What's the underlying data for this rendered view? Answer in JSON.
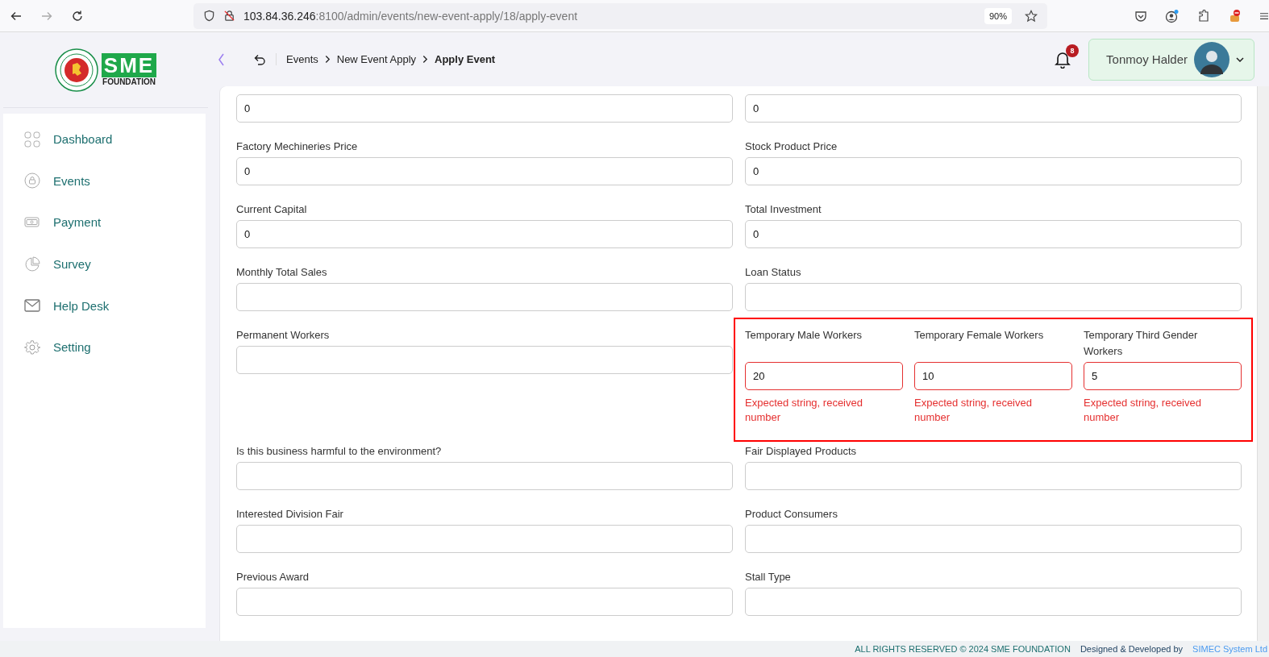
{
  "browser": {
    "url_host": "103.84.36.246",
    "url_path": ":8100/admin/events/new-event-apply/18/apply-event",
    "zoom": "90%"
  },
  "header": {
    "breadcrumb": [
      {
        "label": "Events",
        "current": false
      },
      {
        "label": "New Event Apply",
        "current": false
      },
      {
        "label": "Apply Event",
        "current": true
      }
    ],
    "notification_count": "8",
    "user_name": "Tonmoy Halder"
  },
  "sidebar": {
    "logo_text": "SME",
    "logo_subtext": "FOUNDATION",
    "items": [
      {
        "label": "Dashboard"
      },
      {
        "label": "Events"
      },
      {
        "label": "Payment"
      },
      {
        "label": "Survey"
      },
      {
        "label": "Help Desk"
      },
      {
        "label": "Setting"
      }
    ]
  },
  "form": {
    "rows": [
      [
        {
          "kind": "field",
          "value": "0"
        },
        {
          "kind": "field",
          "value": "0"
        }
      ],
      [
        {
          "kind": "field",
          "label": "Factory Mechineries Price",
          "value": "0"
        },
        {
          "kind": "field",
          "label": "Stock Product Price",
          "value": "0"
        }
      ],
      [
        {
          "kind": "field",
          "label": "Current Capital",
          "value": "0"
        },
        {
          "kind": "field",
          "label": "Total Investment",
          "value": "0"
        }
      ],
      [
        {
          "kind": "field",
          "label": "Monthly Total Sales"
        },
        {
          "kind": "field",
          "label": "Loan Status"
        }
      ],
      [
        {
          "kind": "field",
          "label": "Permanent Workers"
        },
        {
          "kind": "group",
          "highlighted": true,
          "fields": [
            {
              "label": "Temporary Male Workers",
              "value": "20",
              "error": "Expected string, received number"
            },
            {
              "label": "Temporary Female Workers",
              "value": "10",
              "error": "Expected string, received number"
            },
            {
              "label": "Temporary Third Gender Workers",
              "value": "5",
              "error": "Expected string, received number"
            }
          ]
        }
      ],
      [
        {
          "kind": "field",
          "label": "Is this business harmful to the environment?"
        },
        {
          "kind": "field",
          "label": "Fair Displayed Products"
        }
      ],
      [
        {
          "kind": "field",
          "label": "Interested Division Fair"
        },
        {
          "kind": "field",
          "label": "Product Consumers"
        }
      ],
      [
        {
          "kind": "field",
          "label": "Previous Award"
        },
        {
          "kind": "field",
          "label": "Stall Type"
        }
      ]
    ]
  },
  "footer": {
    "rights": "ALL RIGHTS RESERVED © 2024 SME FOUNDATION",
    "credit": "Designed & Developed by",
    "credit_link": "SIMEC System Ltd"
  }
}
